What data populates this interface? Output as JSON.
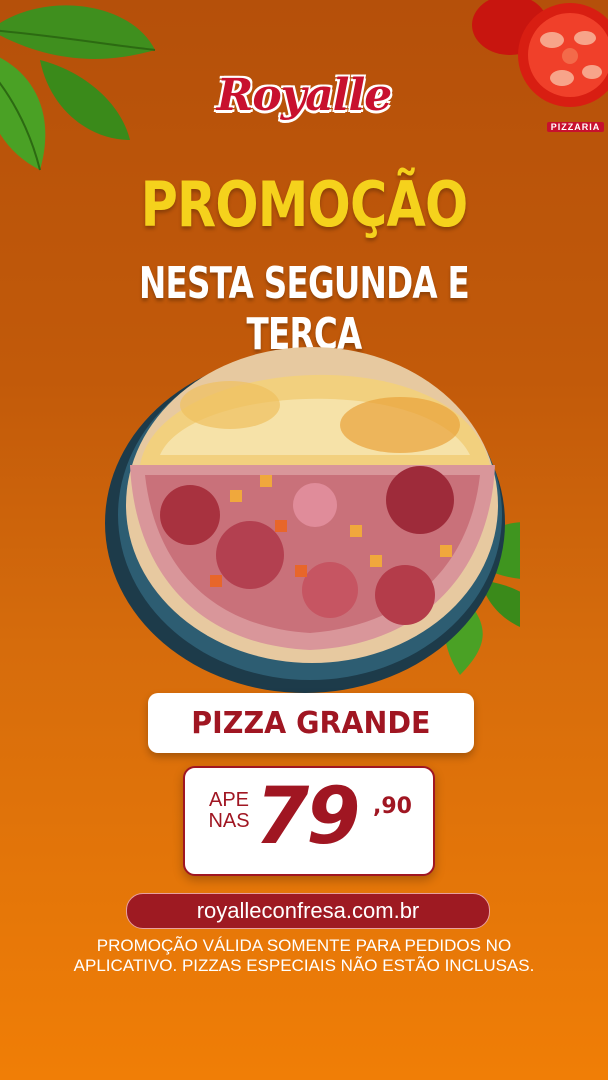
{
  "brand": {
    "name": "Royalle",
    "subtitle": "PIZZARIA"
  },
  "headline": {
    "line1": "PROMOÇÃO",
    "line2": "NESTA SEGUNDA E TERÇA"
  },
  "product": {
    "size_label": "PIZZA GRANDE"
  },
  "price": {
    "prefix_line1": "APE",
    "prefix_line2": "NAS",
    "whole": "79",
    "cents": ",90"
  },
  "website": "royalleconfresa.com.br",
  "disclaimer": {
    "line1": "PROMOÇÃO VÁLIDA SOMENTE PARA PEDIDOS NO",
    "line2": "APLICATIVO. PIZZAS ESPECIAIS NÃO ESTÃO INCLUSAS."
  },
  "colors": {
    "accent_red": "#a01622",
    "headline_yellow": "#f5d21c",
    "bg_orange": "#d66c0c"
  },
  "images": [
    "basil-leaves",
    "tomato-slices",
    "pizza-photo"
  ]
}
